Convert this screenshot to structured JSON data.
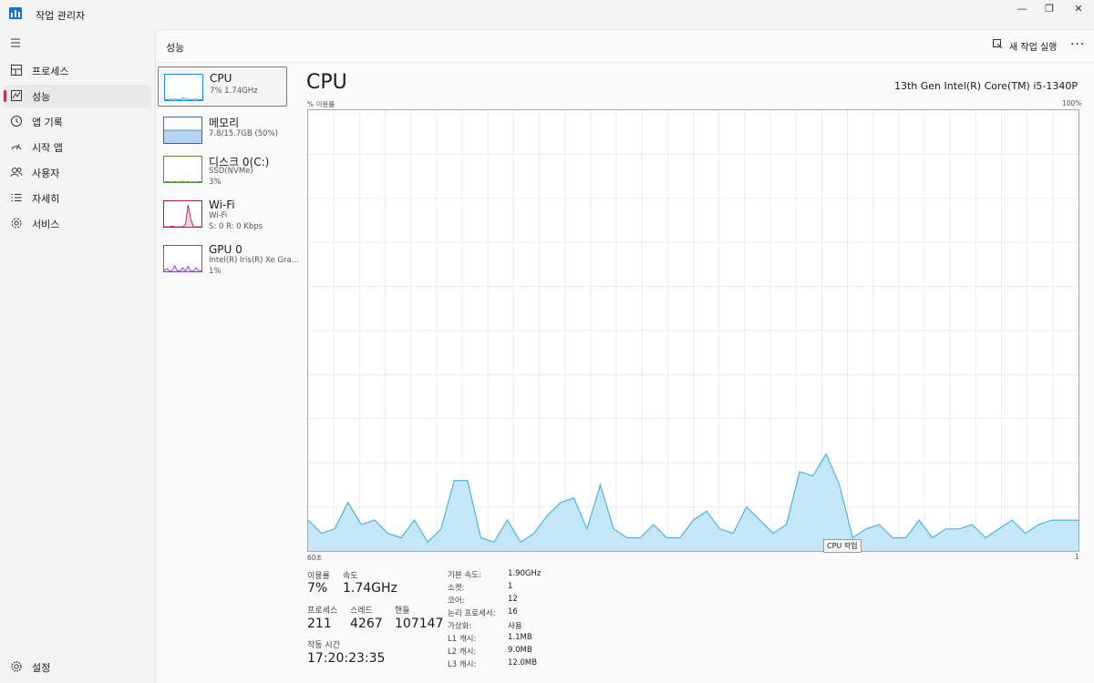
{
  "window": {
    "title": "작업 관리자",
    "min": "—",
    "max": "❐",
    "close": "✕"
  },
  "nav": {
    "items": [
      {
        "label": "프로세스",
        "icon": "processes-icon"
      },
      {
        "label": "성능",
        "icon": "performance-icon",
        "active": true
      },
      {
        "label": "앱 기록",
        "icon": "app-history-icon"
      },
      {
        "label": "시작 앱",
        "icon": "startup-apps-icon"
      },
      {
        "label": "사용자",
        "icon": "users-icon"
      },
      {
        "label": "자세히",
        "icon": "details-icon"
      },
      {
        "label": "서비스",
        "icon": "services-icon"
      }
    ],
    "settings": "설정"
  },
  "header": {
    "title": "성능",
    "run_task": "새 작업 실행",
    "more": "···"
  },
  "resources": [
    {
      "name": "CPU",
      "lines": [
        "7% 1.74GHz"
      ],
      "color": "#1e90c8",
      "fill": "#d7eefa"
    },
    {
      "name": "메모리",
      "lines": [
        "7.8/15.7GB (50%)"
      ],
      "color": "#2a6fb5",
      "fill": "#b8d3f0"
    },
    {
      "name": "디스크 0(C:)",
      "lines": [
        "SSD(NVMe)",
        "3%"
      ],
      "color": "#4f8f2f",
      "fill": "#e6f2d8"
    },
    {
      "name": "Wi-Fi",
      "lines": [
        "Wi-Fi",
        "S: 0  R: 0 Kbps"
      ],
      "color": "#b2134a",
      "fill": "#f5d0de"
    },
    {
      "name": "GPU 0",
      "lines": [
        "Intel(R) Iris(R) Xe Gra...",
        "1%"
      ],
      "color": "#8d3fcf",
      "fill": "#e8d8f7"
    }
  ],
  "detail": {
    "title": "CPU",
    "model": "13th Gen Intel(R) Core(TM) i5-1340P",
    "y_label": "% 이용률",
    "y_max_label": "100%",
    "x_left_label": "60초",
    "x_right_label": "1",
    "tooltip": "CPU 작업"
  },
  "chart_data": {
    "type": "area",
    "ylabel": "% 이용률",
    "ylim": [
      0,
      100
    ],
    "x_labels": [
      "60초",
      "1"
    ],
    "color": "#4fb3e0",
    "fill": "#c3e7f7",
    "values": [
      7,
      4,
      5,
      11,
      6,
      7,
      4,
      3,
      7,
      2,
      5,
      16,
      16,
      3,
      2,
      7,
      2,
      4,
      8,
      11,
      12,
      5,
      15,
      5,
      3,
      3,
      6,
      3,
      3,
      7,
      9,
      5,
      4,
      10,
      7,
      4,
      6,
      18,
      17,
      22,
      15,
      3,
      5,
      6,
      3,
      3,
      7,
      3,
      5,
      5,
      6,
      3,
      5,
      7,
      4,
      6,
      7,
      7,
      7
    ]
  },
  "stats": {
    "utilization": {
      "label": "이용률",
      "value": "7%"
    },
    "speed": {
      "label": "속도",
      "value": "1.74GHz"
    },
    "processes": {
      "label": "프로세스",
      "value": "211"
    },
    "threads": {
      "label": "스레드",
      "value": "4267"
    },
    "handles": {
      "label": "핸들",
      "value": "107147"
    },
    "uptime": {
      "label": "작동 시간",
      "value": "17:20:23:35"
    }
  },
  "info": [
    {
      "key": "기본 속도:",
      "value": "1.90GHz"
    },
    {
      "key": "소켓:",
      "value": "1"
    },
    {
      "key": "코어:",
      "value": "12"
    },
    {
      "key": "논리 프로세서:",
      "value": "16"
    },
    {
      "key": "가상화:",
      "value": "사용"
    },
    {
      "key": "L1 캐시:",
      "value": "1.1MB"
    },
    {
      "key": "L2 캐시:",
      "value": "9.0MB"
    },
    {
      "key": "L3 캐시:",
      "value": "12.0MB"
    }
  ],
  "resource_history": {
    "cpu": [
      3,
      2,
      4,
      3,
      5,
      2,
      3,
      8,
      4,
      3,
      2,
      4,
      3,
      2,
      3
    ],
    "memory": [
      50,
      50,
      50,
      50,
      50,
      50,
      50,
      50,
      50,
      50,
      50,
      50,
      50,
      50,
      50
    ],
    "disk": [
      0,
      2,
      1,
      0,
      3,
      0,
      1,
      4,
      0,
      2,
      0,
      1,
      0,
      3,
      1
    ],
    "wifi": [
      0,
      0,
      0,
      2,
      0,
      0,
      0,
      0,
      10,
      85,
      30,
      0,
      0,
      0,
      0
    ],
    "gpu": [
      2,
      12,
      1,
      3,
      22,
      1,
      2,
      15,
      1,
      20,
      2,
      1,
      14,
      3,
      1
    ]
  }
}
